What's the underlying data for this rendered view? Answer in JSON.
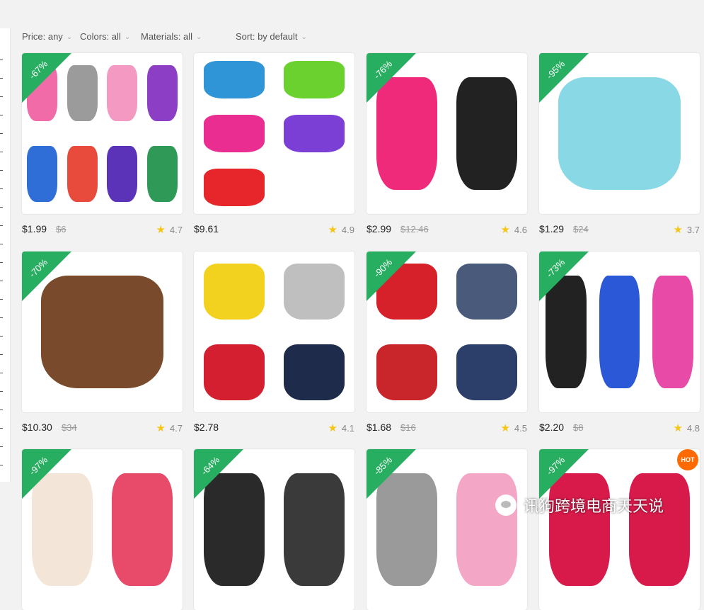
{
  "filters": {
    "price": "Price: any",
    "colors": "Colors: all",
    "materials": "Materials: all",
    "sort": "Sort: by default",
    "chevron_icon": "chevron-down-icon"
  },
  "products": [
    {
      "discount": "-67%",
      "price": "$1.99",
      "old_price": "$6",
      "rating": "4.7",
      "art": [
        "#f06ba8",
        "#9b9b9b",
        "#f49ac2",
        "#8c3fc4",
        "#2e6ed6",
        "#e84a3c",
        "#5a33b8",
        "#2f9a57"
      ]
    },
    {
      "discount": "",
      "price": "$9.61",
      "old_price": "",
      "rating": "4.9",
      "art": [
        "#2f95d6",
        "#6bd12e",
        "#ea2e91",
        "#7b3fd6",
        "#e6262a"
      ]
    },
    {
      "discount": "-76%",
      "price": "$2.99",
      "old_price": "$12.46",
      "rating": "4.6",
      "art": [
        "#f02a7a",
        "#222222"
      ]
    },
    {
      "discount": "-95%",
      "price": "$1.29",
      "old_price": "$24",
      "rating": "3.7",
      "art": [
        "#89d8e6"
      ]
    },
    {
      "discount": "-70%",
      "price": "$10.30",
      "old_price": "$34",
      "rating": "4.7",
      "art": [
        "#7a4a2c"
      ]
    },
    {
      "discount": "",
      "price": "$2.78",
      "old_price": "",
      "rating": "4.1",
      "art": [
        "#f2d21e",
        "#bfbfbf",
        "#d31f30",
        "#1e2b4a"
      ]
    },
    {
      "discount": "-90%",
      "price": "$1.68",
      "old_price": "$16",
      "rating": "4.5",
      "art": [
        "#d6202a",
        "#4a5a7a",
        "#c8262a",
        "#2c3e6a"
      ]
    },
    {
      "discount": "-73%",
      "price": "$2.20",
      "old_price": "$8",
      "rating": "4.8",
      "art": [
        "#222222",
        "#2a58d6",
        "#e84aa8"
      ]
    },
    {
      "discount": "-97%",
      "price": "",
      "old_price": "",
      "rating": "",
      "art": [
        "#f3e6d8",
        "#e84a6a"
      ]
    },
    {
      "discount": "-64%",
      "price": "",
      "old_price": "",
      "rating": "",
      "art": [
        "#2a2a2a",
        "#3a3a3a"
      ]
    },
    {
      "discount": "-85%",
      "price": "",
      "old_price": "",
      "rating": "",
      "art": [
        "#9a9a9a",
        "#f4a6c6"
      ]
    },
    {
      "discount": "-97%",
      "price": "",
      "old_price": "",
      "rating": "",
      "art": [
        "#d81a4a",
        "#d81a4a"
      ]
    }
  ],
  "hot_badge": "HOT",
  "watermark_text": "讯狗跨境电商天天说"
}
